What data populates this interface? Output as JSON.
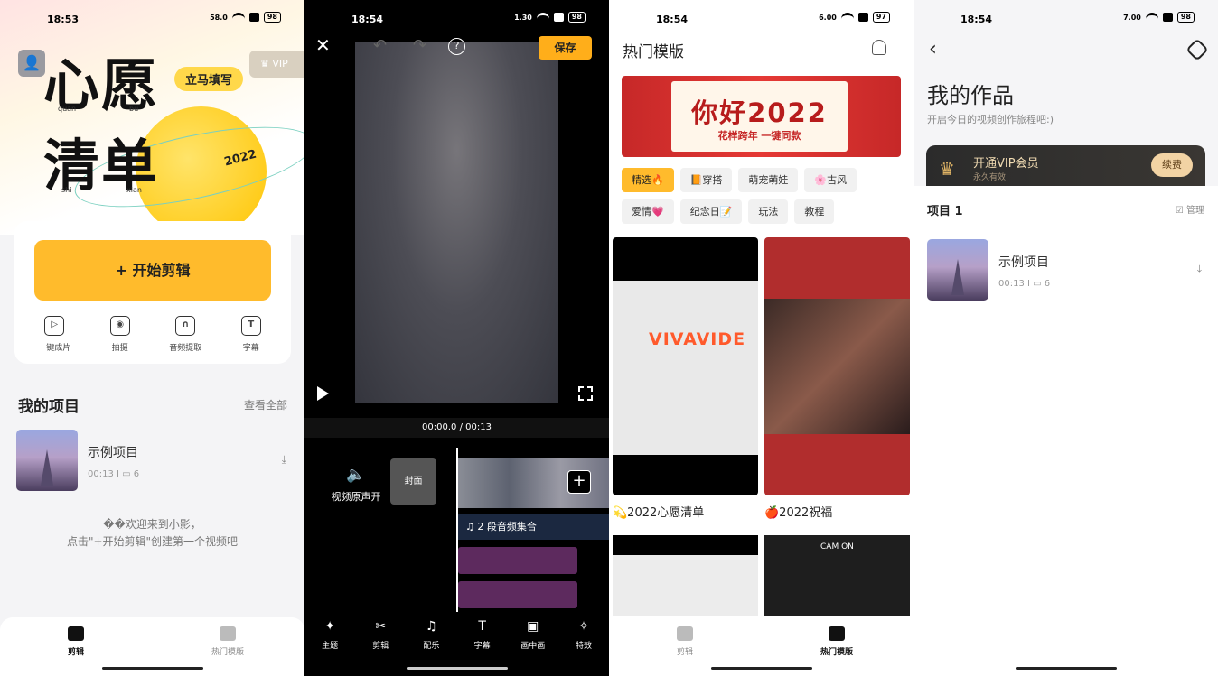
{
  "panel1": {
    "status": {
      "time": "18:53",
      "speed": "58.0",
      "battery": "98"
    },
    "hero": {
      "big1": "心愿",
      "big2": "清单",
      "pin1": "quan",
      "pin2": "bu",
      "pin3": "shi",
      "pin4": "xian",
      "fill_tag": "立马填写",
      "vip": "VIP",
      "year": "2022"
    },
    "start_button": "+ 开始剪辑",
    "tools": [
      {
        "label": "一键成片",
        "icon": "▷"
      },
      {
        "label": "拍摄",
        "icon": "◉"
      },
      {
        "label": "音频提取",
        "icon": "∩"
      },
      {
        "label": "字幕",
        "icon": "T"
      }
    ],
    "section_title": "我的项目",
    "see_all": "查看全部",
    "project": {
      "name": "示例项目",
      "meta": "00:13  I  ▭ 6"
    },
    "welcome_line1": "��欢迎来到小影，",
    "welcome_line2": "点击\"+开始剪辑\"创建第一个视频吧",
    "nav": {
      "edit": "剪辑",
      "templates": "热门模版"
    }
  },
  "panel2": {
    "status": {
      "time": "18:54",
      "speed": "1.30",
      "battery": "98"
    },
    "save": "保存",
    "help": "?",
    "timecode": "00:00.0 / 00:13",
    "mute_label": "视频原声开",
    "cover_label": "封面",
    "audio_label": "♫ 2 段音频集合",
    "toolbar": [
      "主题",
      "剪辑",
      "配乐",
      "字幕",
      "画中画",
      "特效"
    ],
    "toolbar_icons": [
      "✦",
      "✂",
      "♫",
      "T",
      "▣",
      "✧"
    ]
  },
  "panel3": {
    "status": {
      "time": "18:54",
      "speed": "6.00",
      "battery": "97"
    },
    "title": "热门模版",
    "banner_title": "你好2022",
    "banner_sub": "花样跨年 一键同款",
    "chips": [
      "精选🔥",
      "📙穿搭",
      "萌宠萌娃",
      "🌸古风",
      "爱情💗",
      "纪念日📝",
      "玩法",
      "教程"
    ],
    "template_a_brand": "VIVAVIDE",
    "template_a_label": "💫2022心愿清单",
    "template_b_label": "🍎2022祝福",
    "template_d_text": "CAM ON",
    "nav": {
      "edit": "剪辑",
      "templates": "热门模版"
    }
  },
  "panel4": {
    "status": {
      "time": "18:54",
      "speed": "7.00",
      "battery": "98"
    },
    "title": "我的作品",
    "subtitle": "开启今日的视频创作旅程吧:)",
    "vip_title": "开通VIP会员",
    "vip_sub": "永久有效",
    "renew": "续费",
    "project_header": "项目 1",
    "manage": "☑ 管理",
    "project": {
      "name": "示例项目",
      "meta": "00:13  I  ▭ 6"
    }
  }
}
